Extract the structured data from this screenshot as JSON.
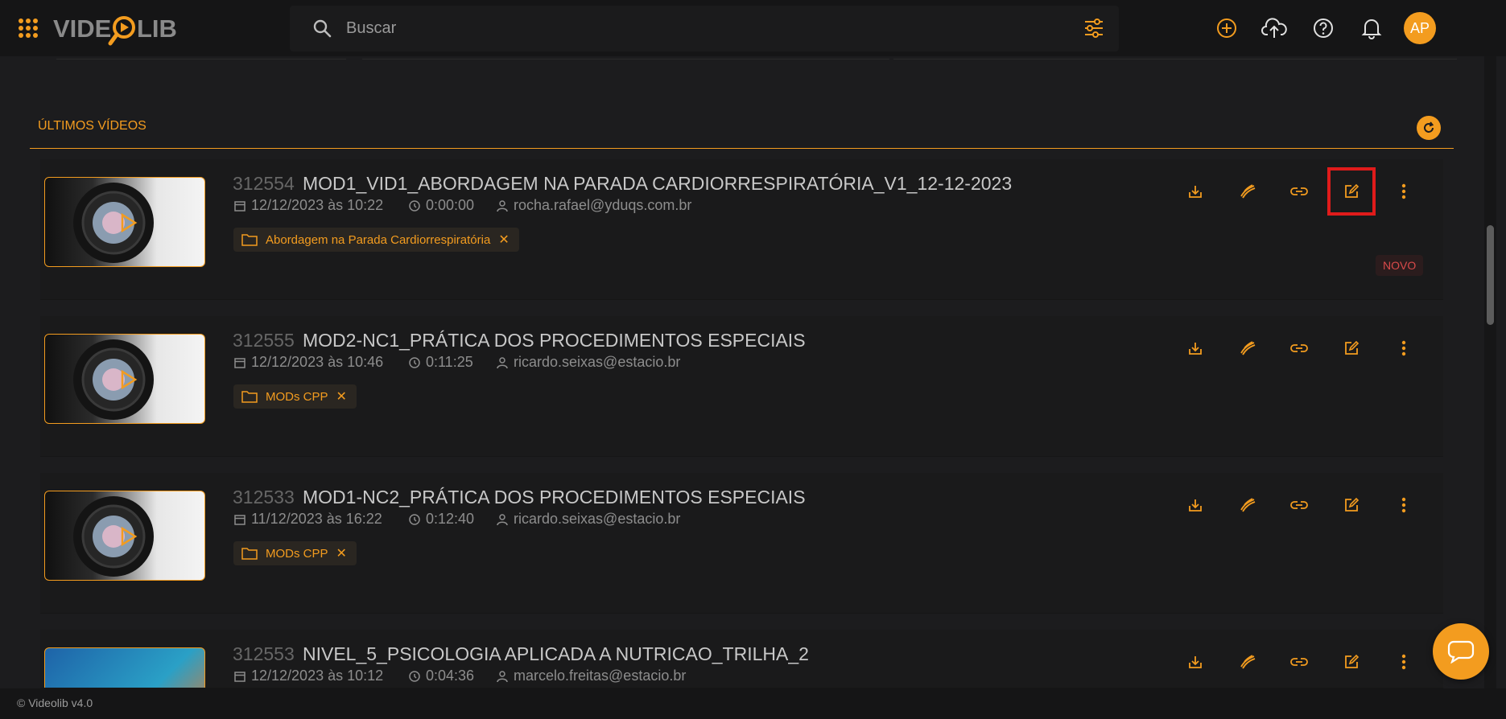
{
  "app": {
    "logo_text": "VIDEOLIB",
    "accent_color": "#f39c1f"
  },
  "search": {
    "placeholder": "Buscar"
  },
  "header": {
    "icons": [
      "add-circle-icon",
      "cloud-upload-icon",
      "help-icon",
      "bell-icon"
    ],
    "avatar_initials": "AP"
  },
  "section": {
    "title": "ÚLTIMOS VÍDEOS"
  },
  "videos": [
    {
      "id": "312554",
      "title": "MOD1_VID1_ABORDAGEM NA PARADA CARDIORRESPIRATÓRIA_V1_12-12-2023",
      "date": "12/12/2023 às 10:22",
      "duration": "0:00:00",
      "author": "rocha.rafael@yduqs.com.br",
      "folder": "Abordagem na Parada Cardiorrespiratória",
      "badge": "NOVO"
    },
    {
      "id": "312555",
      "title": "MOD2-NC1_PRÁTICA DOS PROCEDIMENTOS ESPECIAIS",
      "date": "12/12/2023 às 10:46",
      "duration": "0:11:25",
      "author": "ricardo.seixas@estacio.br",
      "folder": "MODs CPP"
    },
    {
      "id": "312533",
      "title": "MOD1-NC2_PRÁTICA DOS PROCEDIMENTOS ESPECIAIS",
      "date": "11/12/2023 às 16:22",
      "duration": "0:12:40",
      "author": "ricardo.seixas@estacio.br",
      "folder": "MODs CPP"
    },
    {
      "id": "312553",
      "title": "NIVEL_5_PSICOLOGIA APLICADA A NUTRICAO_TRILHA_2",
      "date": "12/12/2023 às 10:12",
      "duration": "0:04:36",
      "author": "marcelo.freitas@estacio.br"
    }
  ],
  "actions": [
    "download-icon",
    "magic-icon",
    "link-icon",
    "edit-icon",
    "more-vert-icon"
  ],
  "footer": {
    "text": "© Videolib v4.0"
  }
}
